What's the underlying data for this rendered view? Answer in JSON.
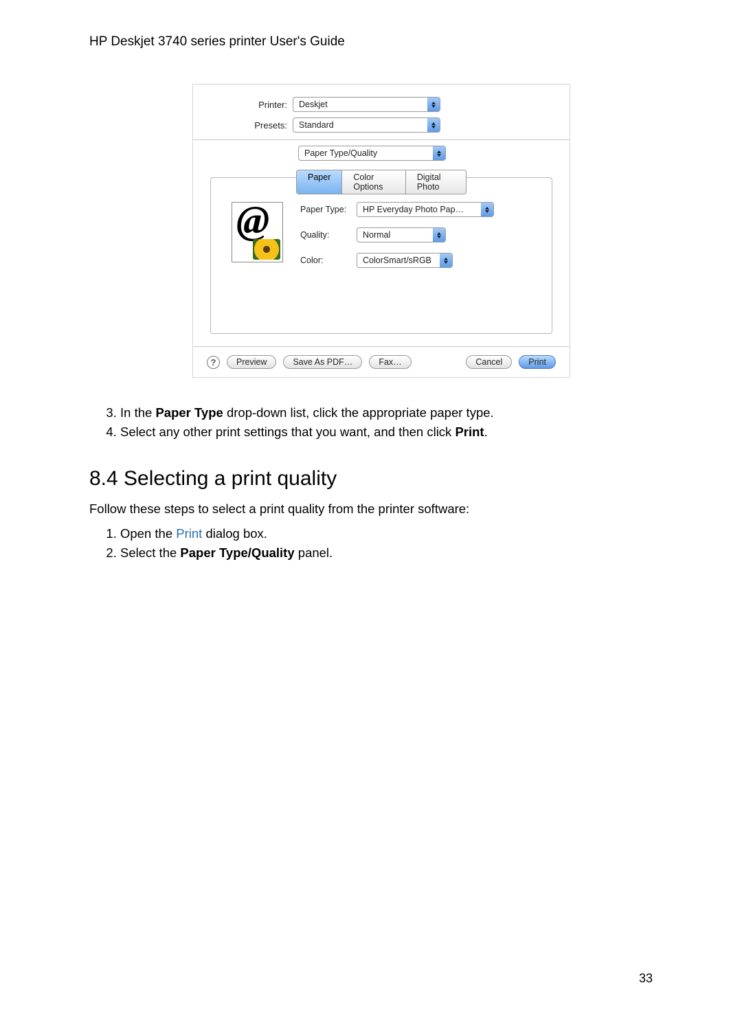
{
  "doc": {
    "header": "HP Deskjet 3740 series printer User's Guide",
    "page_number": "33"
  },
  "dialog": {
    "printer_label": "Printer:",
    "presets_label": "Presets:",
    "printer_value": "Deskjet",
    "presets_value": "Standard",
    "panel_value": "Paper Type/Quality",
    "tabs": {
      "paper": "Paper",
      "color_options": "Color Options",
      "digital_photo": "Digital Photo"
    },
    "fields": {
      "paper_type_label": "Paper Type:",
      "paper_type_value": "HP Everyday Photo Pap…",
      "quality_label": "Quality:",
      "quality_value": "Normal",
      "color_label": "Color:",
      "color_value": "ColorSmart/sRGB"
    },
    "buttons": {
      "help": "?",
      "preview": "Preview",
      "save_pdf": "Save As PDF…",
      "fax": "Fax…",
      "cancel": "Cancel",
      "print": "Print"
    }
  },
  "instructions_upper": {
    "item3_prefix": "In the ",
    "item3_bold": "Paper Type",
    "item3_suffix": " drop-down list, click the appropriate paper type.",
    "item4_prefix": "Select any other print settings that you want, and then click ",
    "item4_bold": "Print",
    "item4_suffix": "."
  },
  "section": {
    "heading": "8.4  Selecting a print quality",
    "intro": "Follow these steps to select a print quality from the printer software:"
  },
  "instructions_lower": {
    "item1_prefix": "Open the ",
    "item1_link": "Print",
    "item1_suffix": " dialog box.",
    "item2_prefix": "Select the ",
    "item2_bold": "Paper Type/Quality",
    "item2_suffix": " panel."
  }
}
